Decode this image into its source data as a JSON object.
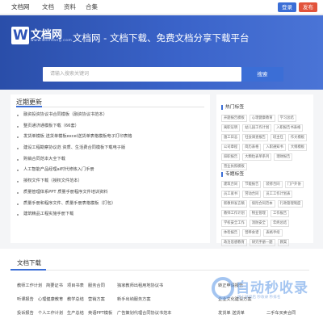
{
  "topbar": {
    "brand": "文档网",
    "nav": [
      "文档",
      "资料",
      "合集"
    ],
    "login": "登录",
    "publish": "发布"
  },
  "hero": {
    "logo_letter": "W",
    "logo_text": "文档网",
    "logo_sub": "www.wendang.com",
    "title": "文档网 - 文档下载、免费文档分享下载平台",
    "search_placeholder": "请输入搜索关键词",
    "search_button": "搜索"
  },
  "recent": {
    "title": "近期更新",
    "items": [
      "融资投资协议书合同模板（融资协议书范本）",
      "整页通济通模板下载（66套）",
      "发货单模板 送货单模板excel送货单表格模板电子打印表格",
      "建设工程勘察协议范 资质、生活费合同模板下载电子版",
      "购销合同范本大全下载",
      "人工智能产品经理ai时代修炼入门手册",
      "授权文件下载（授权文件范本）",
      "质量管理体系PPT 质量手册程序文件培训资料",
      "质量手册和程序文件、质量手册表格模板（打包）",
      "建筑精品工程实施手册下载"
    ]
  },
  "hot": {
    "title": "热门标签",
    "tags": [
      "开题报告模板",
      "心理健康教育",
      "学习总结",
      "离职证明",
      "幼儿园工作计划",
      "入职报告书表格",
      "施工日志",
      "社会调查报告",
      "班主任",
      "作文模板",
      "公司章程",
      "简历表格",
      "入职通知书",
      "大纲模板",
      "辞职报告",
      "大颗粒表单系列",
      "理财报告",
      "营业执照模板"
    ]
  },
  "topic": {
    "title": "专题标签",
    "tags": [
      "建筑合同",
      "节能报告",
      "装修合同",
      "门户外协",
      "员工家书",
      "劳动合同",
      "员工工作计划表",
      "新教师发言稿",
      "保险合同范本",
      "行政管理制度",
      "教师工作计划",
      "物业管理",
      "工作报告",
      "学校安全工作",
      "消防安全",
      "年终总结",
      "体检报告",
      "营养食谱",
      "表格手续",
      "政治思想教育",
      "研究手册一题",
      "教案",
      "教学计划"
    ]
  },
  "bottom": {
    "title": "文档下载",
    "row1": [
      "教师工作计划",
      "简要证书",
      "项目书表",
      "服务合同",
      "独家教师出租用地协议书"
    ],
    "row2": [
      "听课报告",
      "心理健康教育",
      "教学总结",
      "营销方案",
      "新手出纳服务方案"
    ],
    "row3": [
      "投诉报告",
      "个人工作计划",
      "生产总结",
      "英语PPT模板",
      "广告策划代理合同协议书范本"
    ],
    "right1": "转正申请报告",
    "right2": "企业文化建设方案",
    "right3": "发货单 送货单",
    "right4": "二手车买卖合同"
  },
  "watermark": {
    "big": "自动秒收录",
    "small": "做上链接后 秒收录 秒排名"
  }
}
